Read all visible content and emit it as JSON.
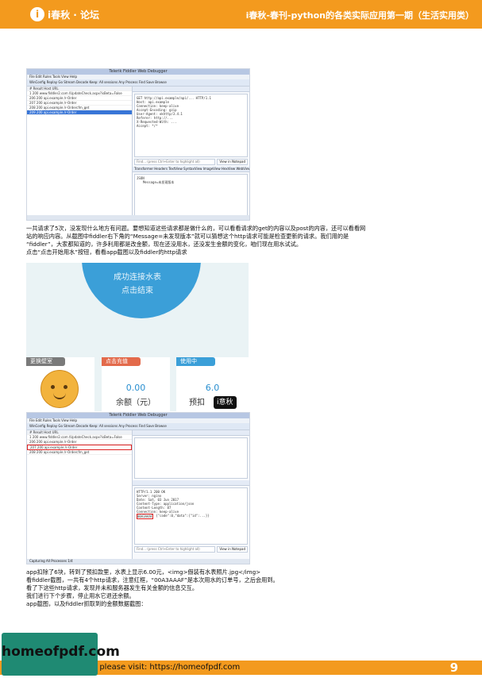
{
  "header": {
    "logo_mark": "i",
    "logo_text": "i春秋 · 论坛",
    "title": "i春秋-春刊-python的各类实际应用第一期（生活实用类）"
  },
  "shot1": {
    "window_title": "Telerik Fiddler Web Debugger",
    "menu": "File  Edit  Rules  Tools  View  Help",
    "toolbar": "WinConfig  Replay  Go  Stream  Decode  Keep: All sessions  Any Process  Find  Save  Browse",
    "columns": "#  Result  Host  URL",
    "rows": [
      "1   200   www.fiddler2.com   /UpdateCheck.aspx?isBeta=False",
      "206  200   api.example   /r-Order",
      "207  200   api.example   /r-Order",
      "208  200   api.example   /r-Ordercfm_get",
      "209  200   api.example   /r-Order"
    ],
    "request_lines": [
      "GET http://api.example/api/...   HTTP/1.1",
      "Host: api.example",
      "Connection: keep-alive",
      "Accept-Encoding: gzip",
      "User-Agent: okhttp/3.4.1",
      "Referer: http://...",
      "X-Requested-With: ...",
      "Accept: */*"
    ],
    "find_placeholder": "Find... (press Ctrl+Enter to highlight all)",
    "find_button": "View in Notepad",
    "resp_tabs": "Transformer  Headers  TextView  SyntaxView  ImageView  HexView  WebView",
    "json_root": "JSON",
    "json_item": "Message=未发现版本"
  },
  "paragraph1": [
    "一共请求了5次，没发现什么地方有问题。要想知道这些请求都是做什么的，可以看看请求的get的内容以及post的内容，还可以看看网",
    "站的响应内容。从截图中fiddler右下角的“Message=未发现版本”就可以猜想这个http请求可能是检查更新的请求。我们用的是",
    "“fiddler”，大家都知道的，许多利用都是改金额，现在还没用水，还没发生金额的变化，咱们现在用水试试。",
    "点击“点击开始用水”按钮，看看app截图以及fiddler的http请求"
  ],
  "app": {
    "circle_line1": "成功连接水表",
    "circle_line2": "点击结束",
    "cards": [
      {
        "header": "更换壁室",
        "header_color": "#7a7a7a"
      },
      {
        "header": "点击充值",
        "header_color": "#e36a4b",
        "value": "0.00",
        "label": "余额（元）"
      },
      {
        "header": "使用中",
        "header_color": "#3b9fd8",
        "value": "6.0",
        "label": "预扣"
      }
    ],
    "watermark": "i意秋"
  },
  "shot3": {
    "window_title": "Telerik Fiddler Web Debugger",
    "menu": "File  Edit  Rules  Tools  View  Help",
    "toolbar": "WinConfig  Replay  Go  Stream  Decode  Keep: All sessions  Any Process  Find  Save  Browse",
    "columns": "#  Result  Host  URL",
    "rows": [
      "1   200   www.fiddler2.com   /UpdateCheck.aspx?isBeta=False",
      "206  200   api.example   /r-Order",
      "207  200   api.example   /r-Order",
      "208  200   api.example   /r-Ordercfm_get"
    ],
    "resp_lines": [
      "HTTP/1.1 200 OK",
      "Server: nginx",
      "Date: Sat, 03 Jun 2017",
      "Content-Type: application/json",
      "Content-Length: 87",
      "Connection: keep-alive",
      "{\"code\":0,\"data\":{\"id\":...}}"
    ],
    "highlight": "00A3AAAF",
    "find_placeholder": "Find... (press Ctrl+Enter to highlight all)",
    "find_button": "View in Notepad",
    "status": "Capturing   All Processes   1/4"
  },
  "paragraph2": [
    "app扣除了6块，转到了预扣款里，水表上显示6.00元，<img>假装有水表照片.jpg</img>",
    "看fiddler截图，一共有4个http请求，注意红框，“00A3AAAF”是本次用水的订单号，之后会用到。",
    "看了下这些http请求，发现并未和服务器发生有关金额的信息交互。",
    "我们进行下个步骤，停止用水它退还余额。",
    "app截图，以及fiddler抓取到的金额数据截图："
  ],
  "footer": {
    "text": "e please visit: https://homeofpdf.com",
    "page_number": "9",
    "badge_text": "homeofpdf.com"
  }
}
